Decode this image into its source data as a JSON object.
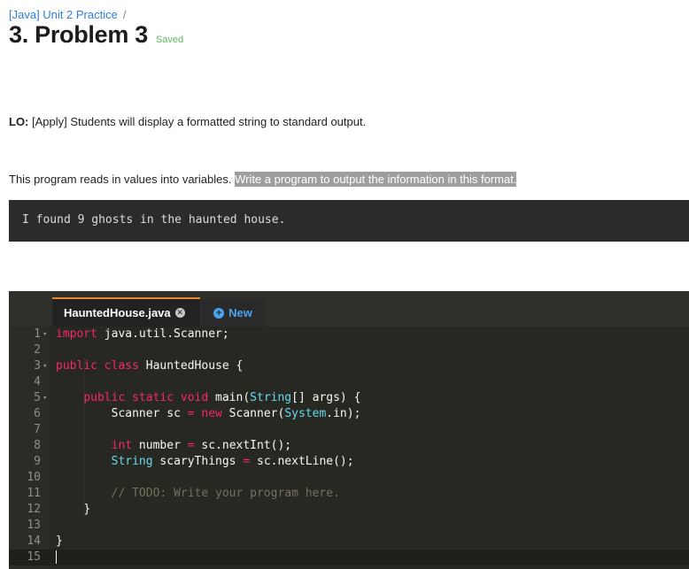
{
  "breadcrumb": {
    "link": "[Java] Unit 2 Practice",
    "separator": "/"
  },
  "header": {
    "title": "3. Problem 3",
    "status": "Saved"
  },
  "learning_objective": {
    "label": "LO:",
    "text": " [Apply] Students will display a formatted string to standard output."
  },
  "description": {
    "text": "This program reads in values into variables. ",
    "highlighted": "Write a program to output the information in this format."
  },
  "expected_output": "I found 9 ghosts in the haunted house.",
  "editor": {
    "tab_label": "HauntedHouse.java",
    "close_icon": "close-circle-icon",
    "new_button_label": "New",
    "new_icon": "plus-circle-icon",
    "line_numbers": [
      "1",
      "2",
      "3",
      "4",
      "5",
      "6",
      "7",
      "8",
      "9",
      "10",
      "11",
      "12",
      "13",
      "14",
      "15"
    ],
    "lines": {
      "l1_kw": "import",
      "l1_rest": " java.util.Scanner;",
      "l3_kw": "public class",
      "l3_rest": " HauntedHouse {",
      "l5_kw1": "public static",
      "l5_ty1": "void",
      "l5_rest1": " main(",
      "l5_ty2": "String",
      "l5_rest2": "[] args) {",
      "l6_a": "Scanner sc ",
      "l6_op": "=",
      "l6_kw": "new",
      "l6_b": " Scanner(",
      "l6_ty": "System",
      "l6_c": ".in);",
      "l8_ty": "int",
      "l8_a": " number ",
      "l8_op": "=",
      "l8_b": " sc.nextInt();",
      "l9_ty": "String",
      "l9_a": " scaryThings ",
      "l9_op": "=",
      "l9_b": " sc.nextLine();",
      "l11_cm": "// TODO: Write your program here.",
      "l12": "}",
      "l14": "}"
    }
  }
}
